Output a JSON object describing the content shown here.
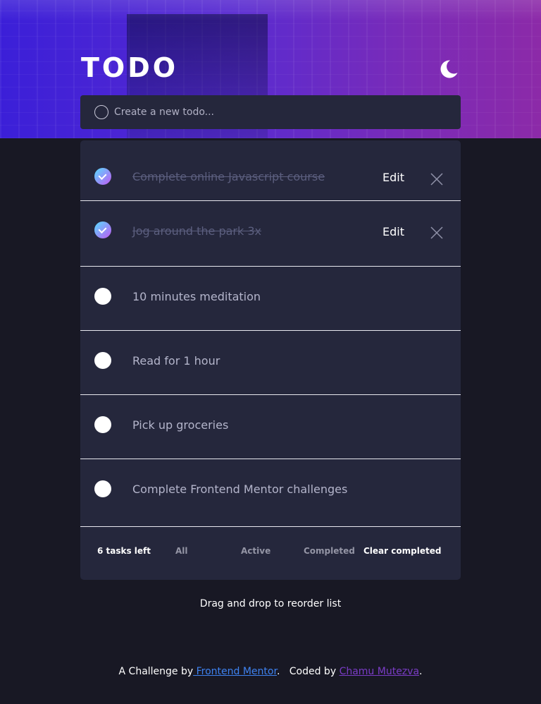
{
  "app": {
    "title": "TODO"
  },
  "new_todo": {
    "placeholder": "Create a new todo..."
  },
  "todos": [
    {
      "text": "Complete online Javascript course",
      "completed": true,
      "edit_label": "Edit"
    },
    {
      "text": "Jog around the park 3x",
      "completed": true,
      "edit_label": "Edit"
    },
    {
      "text": "10 minutes meditation",
      "completed": false
    },
    {
      "text": "Read for 1 hour",
      "completed": false
    },
    {
      "text": "Pick up groceries",
      "completed": false
    },
    {
      "text": "Complete Frontend Mentor challenges",
      "completed": false
    }
  ],
  "footer": {
    "items_left": "6 tasks left",
    "filters": [
      "All",
      "Active",
      "Completed"
    ],
    "clear_label": "Clear completed"
  },
  "hint": "Drag and drop to reorder list",
  "attribution": {
    "prefix": "A Challenge by",
    "fm_link": " Frontend Mentor",
    "middle": ".   Coded by ",
    "author_link": "Chamu Mutezva",
    "suffix": "."
  },
  "icons": {
    "theme": "moon-icon",
    "close": "close-icon",
    "check": "check-icon"
  },
  "colors": {
    "background": "#181824",
    "card": "#25273c",
    "check_gradient_start": "#57ddff",
    "check_gradient_end": "#c058f3",
    "link_blue": "#3e82f0",
    "link_purple": "#7a3cc6"
  }
}
